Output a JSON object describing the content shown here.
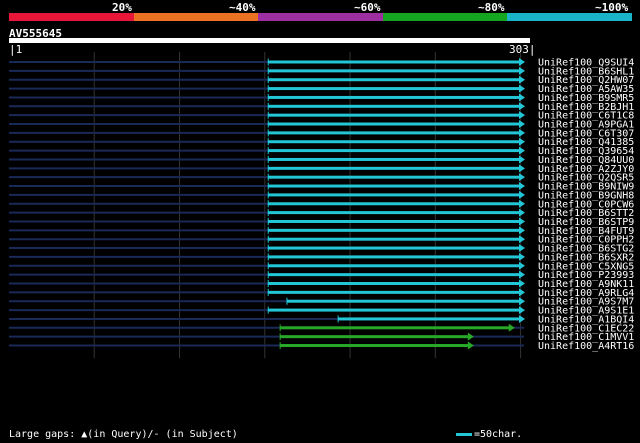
{
  "legend": {
    "labels": [
      "20%",
      "~40%",
      "~60%",
      "~80%",
      "~100%"
    ],
    "colors": [
      "#e8173a",
      "#ea7222",
      "#9e2fa0",
      "#15a520",
      "#1ab4c8"
    ]
  },
  "query": {
    "name": "AV555645",
    "start": "1",
    "end": "303",
    "length": 303
  },
  "colors": {
    "cyan_hit": "#22c6d6",
    "green_hit": "#28a828",
    "grid": "#1a2a58",
    "rule": "#333333"
  },
  "hits": [
    {
      "name": "UniRef100_Q9SUI4",
      "start": 153,
      "end": 303,
      "color": "cyan"
    },
    {
      "name": "UniRef100_B6SHL1",
      "start": 153,
      "end": 303,
      "color": "cyan"
    },
    {
      "name": "UniRef100_Q2HW07",
      "start": 153,
      "end": 303,
      "color": "cyan"
    },
    {
      "name": "UniRef100_A5AW35",
      "start": 153,
      "end": 303,
      "color": "cyan"
    },
    {
      "name": "UniRef100_B9SMR5",
      "start": 153,
      "end": 303,
      "color": "cyan"
    },
    {
      "name": "UniRef100_B2BJH1",
      "start": 153,
      "end": 303,
      "color": "cyan"
    },
    {
      "name": "UniRef100_C6T1C8",
      "start": 153,
      "end": 303,
      "color": "cyan"
    },
    {
      "name": "UniRef100_A9PGA1",
      "start": 153,
      "end": 303,
      "color": "cyan"
    },
    {
      "name": "UniRef100_C6T307",
      "start": 153,
      "end": 303,
      "color": "cyan"
    },
    {
      "name": "UniRef100_Q41385",
      "start": 153,
      "end": 303,
      "color": "cyan"
    },
    {
      "name": "UniRef100_Q39654",
      "start": 153,
      "end": 303,
      "color": "cyan"
    },
    {
      "name": "UniRef100_Q84UU0",
      "start": 153,
      "end": 303,
      "color": "cyan"
    },
    {
      "name": "UniRef100_A2ZJY0",
      "start": 153,
      "end": 303,
      "color": "cyan"
    },
    {
      "name": "UniRef100_Q2QSR5",
      "start": 153,
      "end": 303,
      "color": "cyan"
    },
    {
      "name": "UniRef100_B9NIW9",
      "start": 153,
      "end": 303,
      "color": "cyan"
    },
    {
      "name": "UniRef100_B9GNH8",
      "start": 153,
      "end": 303,
      "color": "cyan"
    },
    {
      "name": "UniRef100_C0PCW6",
      "start": 153,
      "end": 303,
      "color": "cyan"
    },
    {
      "name": "UniRef100_B6STT2",
      "start": 153,
      "end": 303,
      "color": "cyan"
    },
    {
      "name": "UniRef100_B6STP9",
      "start": 153,
      "end": 303,
      "color": "cyan"
    },
    {
      "name": "UniRef100_B4FUT9",
      "start": 153,
      "end": 303,
      "color": "cyan"
    },
    {
      "name": "UniRef100_C0PPH2",
      "start": 153,
      "end": 303,
      "color": "cyan"
    },
    {
      "name": "UniRef100_B6STG2",
      "start": 153,
      "end": 303,
      "color": "cyan"
    },
    {
      "name": "UniRef100_B6SXR2",
      "start": 153,
      "end": 303,
      "color": "cyan"
    },
    {
      "name": "UniRef100_C5XNG5",
      "start": 153,
      "end": 303,
      "color": "cyan"
    },
    {
      "name": "UniRef100_P23993",
      "start": 153,
      "end": 303,
      "color": "cyan"
    },
    {
      "name": "UniRef100_A9NK11",
      "start": 153,
      "end": 303,
      "color": "cyan"
    },
    {
      "name": "UniRef100_A9RLG4",
      "start": 153,
      "end": 303,
      "color": "cyan"
    },
    {
      "name": "UniRef100_A9S7M7",
      "start": 164,
      "end": 303,
      "color": "cyan"
    },
    {
      "name": "UniRef100_A9S1E1",
      "start": 153,
      "end": 303,
      "color": "cyan"
    },
    {
      "name": "UniRef100_A1BQI4",
      "start": 194,
      "end": 303,
      "color": "cyan"
    },
    {
      "name": "UniRef100_C1EC22",
      "start": 160,
      "end": 297,
      "color": "green"
    },
    {
      "name": "UniRef100_C1MVV1",
      "start": 160,
      "end": 273,
      "color": "green"
    },
    {
      "name": "UniRef100_A4RT16",
      "start": 160,
      "end": 273,
      "color": "green"
    }
  ],
  "footer": {
    "gaps_prefix": "Large gaps: ",
    "gaps_suffix": "(in Query)/- (in Subject)"
  },
  "scale_key": {
    "label": "=50char."
  }
}
